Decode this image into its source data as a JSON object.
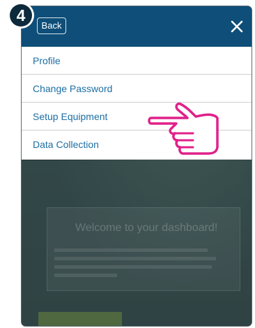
{
  "step_badge": "4",
  "header": {
    "back_label": "Back",
    "close_icon": "close-icon"
  },
  "menu": {
    "items": [
      {
        "label": "Profile"
      },
      {
        "label": "Change Password"
      },
      {
        "label": "Setup Equipment"
      },
      {
        "label": "Data Collection"
      }
    ]
  },
  "background": {
    "welcome_title": "Welcome to your dashboard!"
  },
  "annotation": {
    "pointer_icon": "pointing-hand-icon",
    "color": "#e0218a"
  },
  "colors": {
    "header": "#0e4e78",
    "menu_text": "#1c6ea4",
    "badge": "#0d2a3c"
  }
}
